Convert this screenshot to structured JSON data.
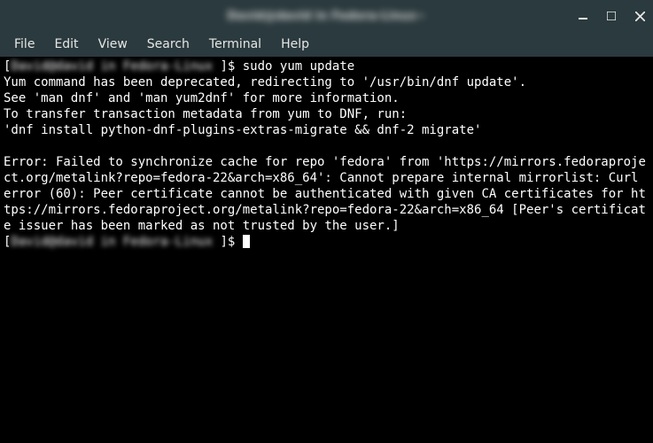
{
  "titlebar": {
    "title": "David@david in Fedora-Linux~"
  },
  "menubar": {
    "items": [
      "File",
      "Edit",
      "View",
      "Search",
      "Terminal",
      "Help"
    ]
  },
  "terminal": {
    "prompt1_user": "David@david in Fedora-Linux ",
    "prompt1_suffix": "]$ ",
    "command1": "sudo yum update",
    "output": "Yum command has been deprecated, redirecting to '/usr/bin/dnf update'.\nSee 'man dnf' and 'man yum2dnf' for more information.\nTo transfer transaction metadata from yum to DNF, run:\n'dnf install python-dnf-plugins-extras-migrate && dnf-2 migrate'\n\nError: Failed to synchronize cache for repo 'fedora' from 'https://mirrors.fedoraproject.org/metalink?repo=fedora-22&arch=x86_64': Cannot prepare internal mirrorlist: Curl error (60): Peer certificate cannot be authenticated with given CA certificates for https://mirrors.fedoraproject.org/metalink?repo=fedora-22&arch=x86_64 [Peer's certificate issuer has been marked as not trusted by the user.]",
    "prompt2_user": "David@david in Fedora-Linux ",
    "prompt2_suffix": "]$ "
  }
}
